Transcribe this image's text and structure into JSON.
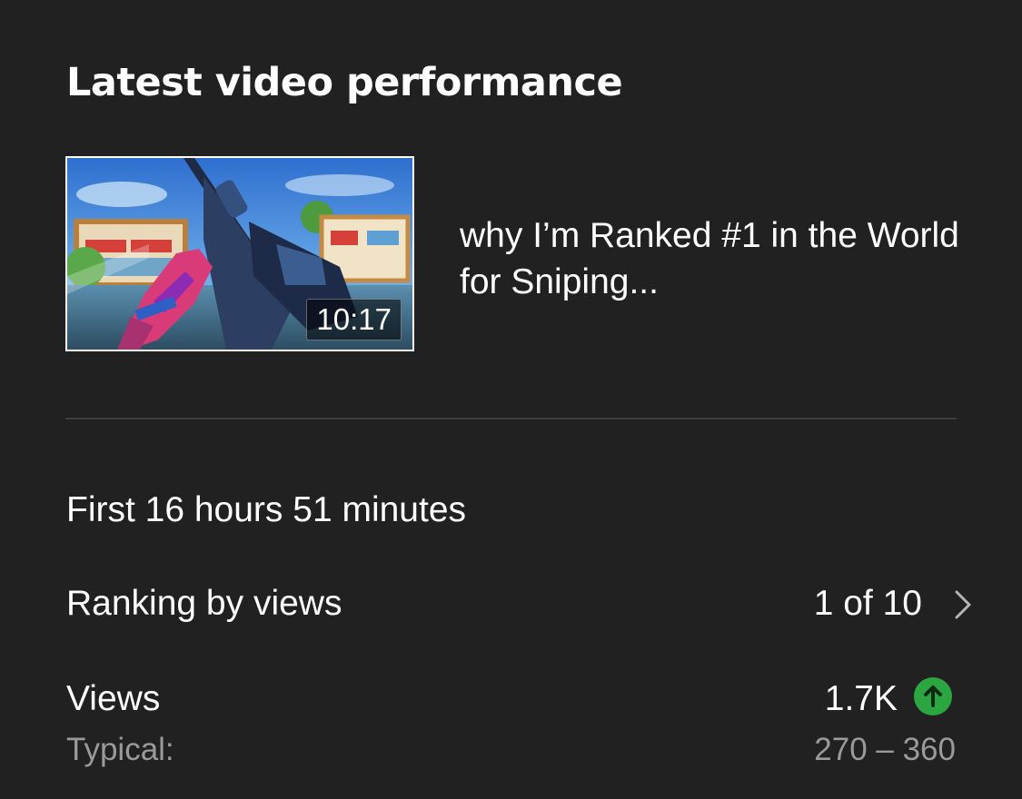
{
  "card": {
    "title": "Latest video performance"
  },
  "video": {
    "title": "why I’m Ranked #1 in the World for Sniping...",
    "duration": "10:17"
  },
  "stats": {
    "period": "First 16 hours 51 minutes",
    "ranking_label": "Ranking by views",
    "ranking_value": "1 of 10",
    "views_label": "Views",
    "views_value": "1.7K",
    "views_trend_icon": "arrow-up-circle-icon",
    "typical_label": "Typical:",
    "typical_value": "270 – 360"
  },
  "colors": {
    "background": "#212121",
    "text": "#ffffff",
    "secondary_text": "#9a9a9a",
    "trend_up": "#2ba640",
    "divider": "#3d3d3d"
  }
}
